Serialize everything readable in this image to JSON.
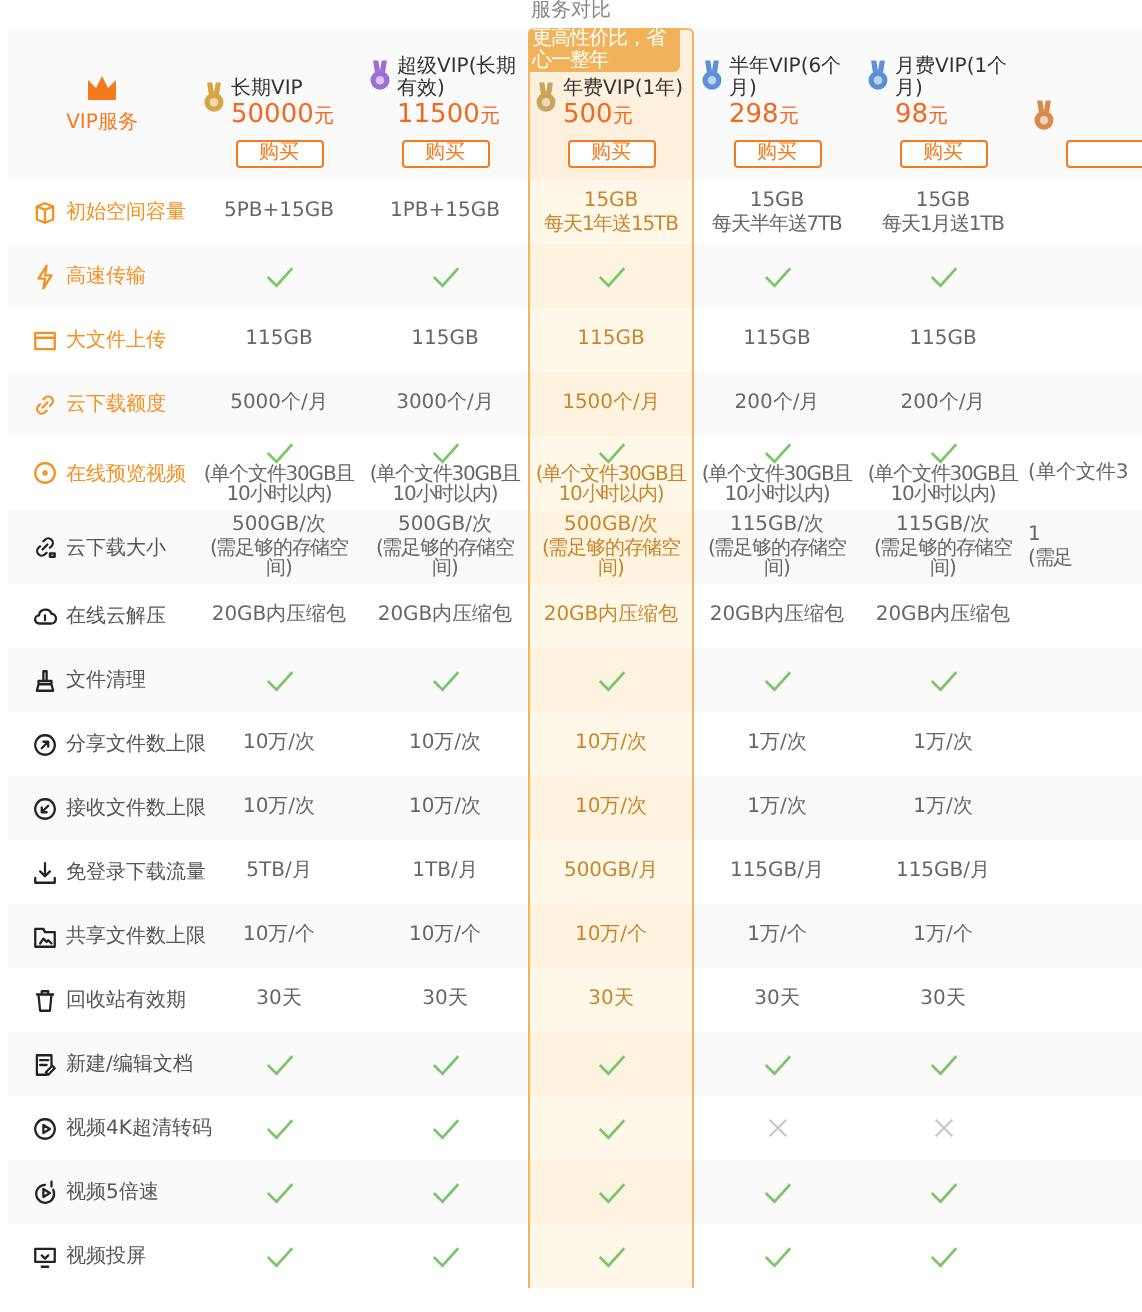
{
  "page_title": "服务对比",
  "corner_label": "VIP服务",
  "badge": "更高性价比，省心一整年",
  "plans": [
    {
      "name": "长期VIP",
      "price": "50000",
      "unit": "元",
      "button": "购买",
      "color": "#d9a441",
      "selected": false
    },
    {
      "name": "超级VIP(长期有效)",
      "price": "11500",
      "unit": "元",
      "button": "购买",
      "color": "#9b6fd6",
      "selected": false
    },
    {
      "name": "年费VIP(1年)",
      "price": "500",
      "unit": "元",
      "button": "购买",
      "color": "#c9a45a",
      "selected": true
    },
    {
      "name": "半年VIP(6个月)",
      "price": "298",
      "unit": "元",
      "button": "购买",
      "color": "#5b8fd6",
      "selected": false
    },
    {
      "name": "月费VIP(1个月)",
      "price": "98",
      "unit": "元",
      "button": "购买",
      "color": "#5b8fd6",
      "selected": false
    },
    {
      "color": "#d98a4a",
      "selected": false
    }
  ],
  "features": [
    {
      "label": "初始空间容量",
      "highlight": true,
      "cells": [
        {
          "kind": "text",
          "lines": [
            "5PB+15GB"
          ]
        },
        {
          "kind": "text",
          "lines": [
            "1PB+15GB"
          ]
        },
        {
          "kind": "text",
          "lines": [
            "15GB",
            "每天1年送15TB"
          ]
        },
        {
          "kind": "text",
          "lines": [
            "15GB",
            "每天半年送7TB"
          ]
        },
        {
          "kind": "text",
          "lines": [
            "15GB",
            "每天1月送1TB"
          ]
        }
      ]
    },
    {
      "label": "高速传输",
      "highlight": true,
      "cells": [
        {
          "kind": "check"
        },
        {
          "kind": "check"
        },
        {
          "kind": "check"
        },
        {
          "kind": "check"
        },
        {
          "kind": "check"
        }
      ]
    },
    {
      "label": "大文件上传",
      "highlight": true,
      "cells": [
        {
          "kind": "text",
          "lines": [
            "115GB"
          ]
        },
        {
          "kind": "text",
          "lines": [
            "115GB"
          ]
        },
        {
          "kind": "text",
          "lines": [
            "115GB"
          ]
        },
        {
          "kind": "text",
          "lines": [
            "115GB"
          ]
        },
        {
          "kind": "text",
          "lines": [
            "115GB"
          ]
        }
      ]
    },
    {
      "label": "云下载额度",
      "highlight": true,
      "cells": [
        {
          "kind": "text",
          "lines": [
            "5000个/月"
          ]
        },
        {
          "kind": "text",
          "lines": [
            "3000个/月"
          ]
        },
        {
          "kind": "text",
          "lines": [
            "1500个/月"
          ]
        },
        {
          "kind": "text",
          "lines": [
            "200个/月"
          ]
        },
        {
          "kind": "text",
          "lines": [
            "200个/月"
          ]
        }
      ]
    },
    {
      "label": "在线预览视频",
      "highlight": true,
      "cells": [
        {
          "kind": "check",
          "note": "(单个文件30GB且10小时以内)"
        },
        {
          "kind": "check",
          "note": "(单个文件30GB且10小时以内)"
        },
        {
          "kind": "check",
          "note": "(单个文件30GB且10小时以内)"
        },
        {
          "kind": "check",
          "note": "(单个文件30GB且10小时以内)"
        },
        {
          "kind": "check",
          "note": "(单个文件30GB且10小时以内)"
        },
        {
          "kind": "text",
          "lines": [
            "(单个文件3"
          ]
        }
      ]
    },
    {
      "label": "云下载大小",
      "highlight": false,
      "cells": [
        {
          "kind": "text",
          "lines": [
            "500GB/次",
            "(需足够的存储空间)"
          ]
        },
        {
          "kind": "text",
          "lines": [
            "500GB/次",
            "(需足够的存储空间)"
          ]
        },
        {
          "kind": "text",
          "lines": [
            "500GB/次",
            "(需足够的存储空间)"
          ]
        },
        {
          "kind": "text",
          "lines": [
            "115GB/次",
            "(需足够的存储空间)"
          ]
        },
        {
          "kind": "text",
          "lines": [
            "115GB/次",
            "(需足够的存储空间)"
          ]
        },
        {
          "kind": "text",
          "lines": [
            "1",
            "(需足"
          ]
        }
      ]
    },
    {
      "label": "在线云解压",
      "highlight": false,
      "cells": [
        {
          "kind": "text",
          "lines": [
            "20GB内压缩包"
          ]
        },
        {
          "kind": "text",
          "lines": [
            "20GB内压缩包"
          ]
        },
        {
          "kind": "text",
          "lines": [
            "20GB内压缩包"
          ]
        },
        {
          "kind": "text",
          "lines": [
            "20GB内压缩包"
          ]
        },
        {
          "kind": "text",
          "lines": [
            "20GB内压缩包"
          ]
        }
      ]
    },
    {
      "label": "文件清理",
      "highlight": false,
      "cells": [
        {
          "kind": "check"
        },
        {
          "kind": "check"
        },
        {
          "kind": "check"
        },
        {
          "kind": "check"
        },
        {
          "kind": "check"
        }
      ]
    },
    {
      "label": "分享文件数上限",
      "highlight": false,
      "cells": [
        {
          "kind": "text",
          "lines": [
            "10万/次"
          ]
        },
        {
          "kind": "text",
          "lines": [
            "10万/次"
          ]
        },
        {
          "kind": "text",
          "lines": [
            "10万/次"
          ]
        },
        {
          "kind": "text",
          "lines": [
            "1万/次"
          ]
        },
        {
          "kind": "text",
          "lines": [
            "1万/次"
          ]
        }
      ]
    },
    {
      "label": "接收文件数上限",
      "highlight": false,
      "cells": [
        {
          "kind": "text",
          "lines": [
            "10万/次"
          ]
        },
        {
          "kind": "text",
          "lines": [
            "10万/次"
          ]
        },
        {
          "kind": "text",
          "lines": [
            "10万/次"
          ]
        },
        {
          "kind": "text",
          "lines": [
            "1万/次"
          ]
        },
        {
          "kind": "text",
          "lines": [
            "1万/次"
          ]
        }
      ]
    },
    {
      "label": "免登录下载流量",
      "highlight": false,
      "cells": [
        {
          "kind": "text",
          "lines": [
            "5TB/月"
          ]
        },
        {
          "kind": "text",
          "lines": [
            "1TB/月"
          ]
        },
        {
          "kind": "text",
          "lines": [
            "500GB/月"
          ]
        },
        {
          "kind": "text",
          "lines": [
            "115GB/月"
          ]
        },
        {
          "kind": "text",
          "lines": [
            "115GB/月"
          ]
        }
      ]
    },
    {
      "label": "共享文件数上限",
      "highlight": false,
      "cells": [
        {
          "kind": "text",
          "lines": [
            "10万/个"
          ]
        },
        {
          "kind": "text",
          "lines": [
            "10万/个"
          ]
        },
        {
          "kind": "text",
          "lines": [
            "10万/个"
          ]
        },
        {
          "kind": "text",
          "lines": [
            "1万/个"
          ]
        },
        {
          "kind": "text",
          "lines": [
            "1万/个"
          ]
        }
      ]
    },
    {
      "label": "回收站有效期",
      "highlight": false,
      "cells": [
        {
          "kind": "text",
          "lines": [
            "30天"
          ]
        },
        {
          "kind": "text",
          "lines": [
            "30天"
          ]
        },
        {
          "kind": "text",
          "lines": [
            "30天"
          ]
        },
        {
          "kind": "text",
          "lines": [
            "30天"
          ]
        },
        {
          "kind": "text",
          "lines": [
            "30天"
          ]
        }
      ]
    },
    {
      "label": "新建/编辑文档",
      "highlight": false,
      "cells": [
        {
          "kind": "check"
        },
        {
          "kind": "check"
        },
        {
          "kind": "check"
        },
        {
          "kind": "check"
        },
        {
          "kind": "check"
        }
      ]
    },
    {
      "label": "视频4K超清转码",
      "highlight": false,
      "cells": [
        {
          "kind": "check"
        },
        {
          "kind": "check"
        },
        {
          "kind": "check"
        },
        {
          "kind": "cross"
        },
        {
          "kind": "cross"
        }
      ]
    },
    {
      "label": "视频5倍速",
      "highlight": false,
      "cells": [
        {
          "kind": "check"
        },
        {
          "kind": "check"
        },
        {
          "kind": "check"
        },
        {
          "kind": "check"
        },
        {
          "kind": "check"
        }
      ]
    },
    {
      "label": "视频投屏",
      "highlight": false,
      "cells": [
        {
          "kind": "check"
        },
        {
          "kind": "check"
        },
        {
          "kind": "check"
        },
        {
          "kind": "check"
        },
        {
          "kind": "check"
        }
      ]
    }
  ]
}
